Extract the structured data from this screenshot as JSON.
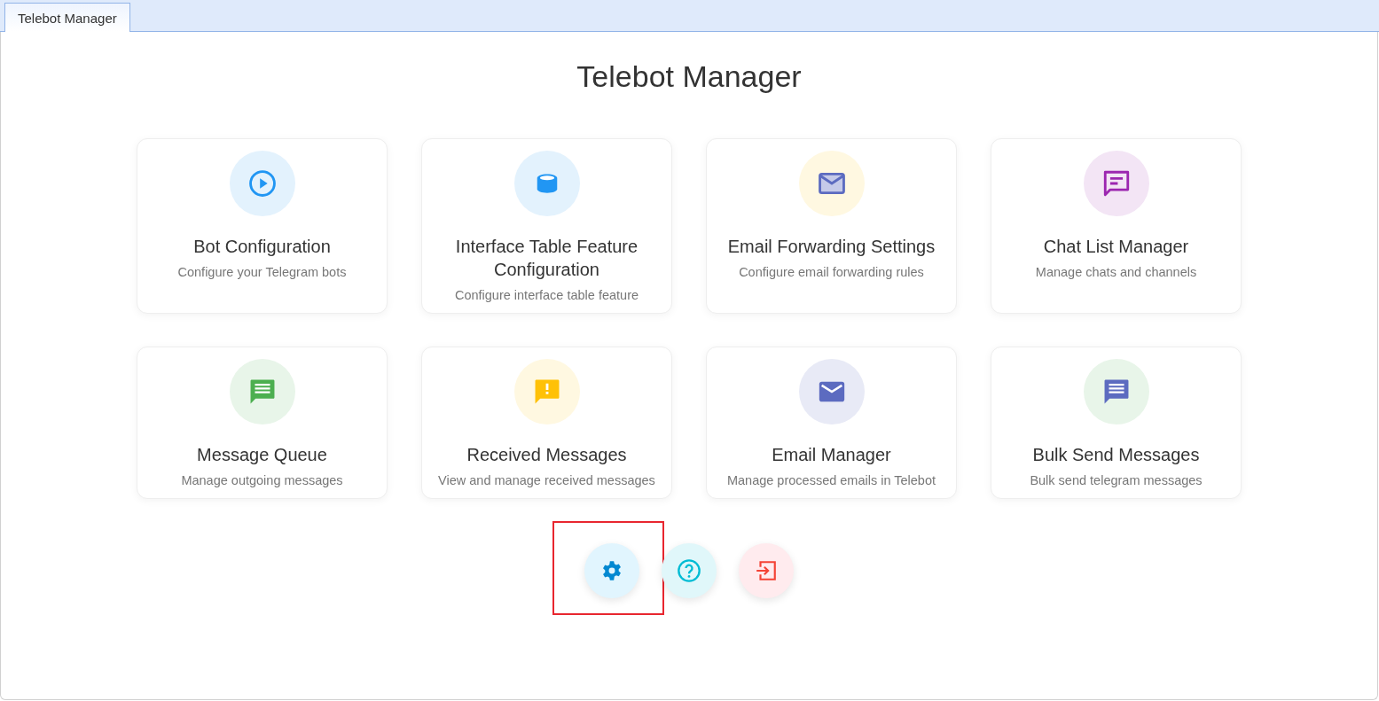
{
  "tabs": [
    {
      "label": "Telebot Manager",
      "selected": true
    }
  ],
  "page_title": "Telebot Manager",
  "cards": [
    {
      "title": "Bot Configuration",
      "description": "Configure your Telegram bots",
      "kind": "play",
      "color": "#2196f3"
    },
    {
      "title": "Interface Table Feature Configuration",
      "description": "Configure interface table feature",
      "kind": "database",
      "color": "#2196f3"
    },
    {
      "title": "Email Forwarding Settings",
      "description": "Configure email forwarding rules",
      "kind": "letter",
      "color": "#5c6bc0"
    },
    {
      "title": "Chat List Manager",
      "description": "Manage chats and channels",
      "kind": "chat",
      "color": "#9c27b0"
    },
    {
      "title": "Message Queue",
      "description": "Manage outgoing messages",
      "kind": "queue",
      "color": "#4caf50"
    },
    {
      "title": "Received Messages",
      "description": "View and manage received messages",
      "kind": "alert",
      "color": "#ffc107"
    },
    {
      "title": "Email Manager",
      "description": "Manage processed emails in Telebot",
      "kind": "mail",
      "color": "#5c6bc0"
    },
    {
      "title": "Bulk Send Messages",
      "description": "Bulk send telegram messages",
      "kind": "queue",
      "color": "#5c6bc0"
    }
  ],
  "actions": [
    {
      "kind": "settings",
      "color": "#0288d1",
      "highlighted": true
    },
    {
      "kind": "help",
      "color": "#00bcd4",
      "highlighted": false
    },
    {
      "kind": "logout",
      "color": "#f44336",
      "highlighted": false
    }
  ]
}
